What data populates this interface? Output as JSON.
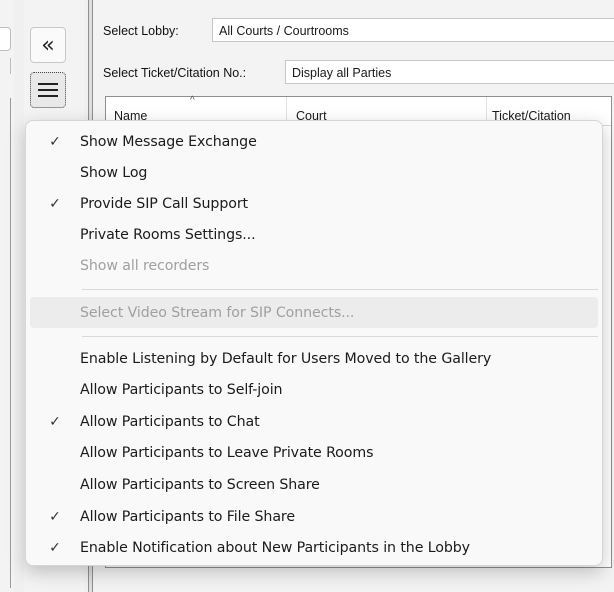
{
  "toolbar": {
    "collapse_icon": "double-chevron-left-icon",
    "collapse_glyph": "«",
    "menu_icon": "hamburger-menu-icon"
  },
  "filters": {
    "lobby_label": "Select Lobby:",
    "lobby_value": "All Courts / Courtrooms",
    "ticket_label": "Select Ticket/Citation No.:",
    "ticket_value": "Display all Parties"
  },
  "grid": {
    "columns": [
      "Name",
      "Court",
      "Ticket/Citation"
    ],
    "sort_glyph": "^"
  },
  "menu": {
    "items": [
      {
        "label": "Show Message Exchange",
        "checked": true,
        "enabled": true
      },
      {
        "label": "Show Log",
        "checked": false,
        "enabled": true
      },
      {
        "label": "Provide SIP Call Support",
        "checked": true,
        "enabled": true
      },
      {
        "label": "Private Rooms Settings...",
        "checked": false,
        "enabled": true
      },
      {
        "label": "Show all recorders",
        "checked": false,
        "enabled": false
      },
      {
        "label": "Select Video Stream for SIP Connects...",
        "checked": false,
        "enabled": false
      },
      {
        "label": "Enable Listening by Default for Users Moved to the Gallery",
        "checked": false,
        "enabled": true
      },
      {
        "label": "Allow Participants to Self-join",
        "checked": false,
        "enabled": true
      },
      {
        "label": "Allow Participants to Chat",
        "checked": true,
        "enabled": true
      },
      {
        "label": "Allow Participants to Leave Private Rooms",
        "checked": false,
        "enabled": true
      },
      {
        "label": "Allow Participants to Screen Share",
        "checked": false,
        "enabled": true
      },
      {
        "label": "Allow Participants to File Share",
        "checked": true,
        "enabled": true
      },
      {
        "label": "Enable Notification about New Participants in the Lobby",
        "checked": true,
        "enabled": true
      }
    ],
    "check_glyph": "✓"
  }
}
